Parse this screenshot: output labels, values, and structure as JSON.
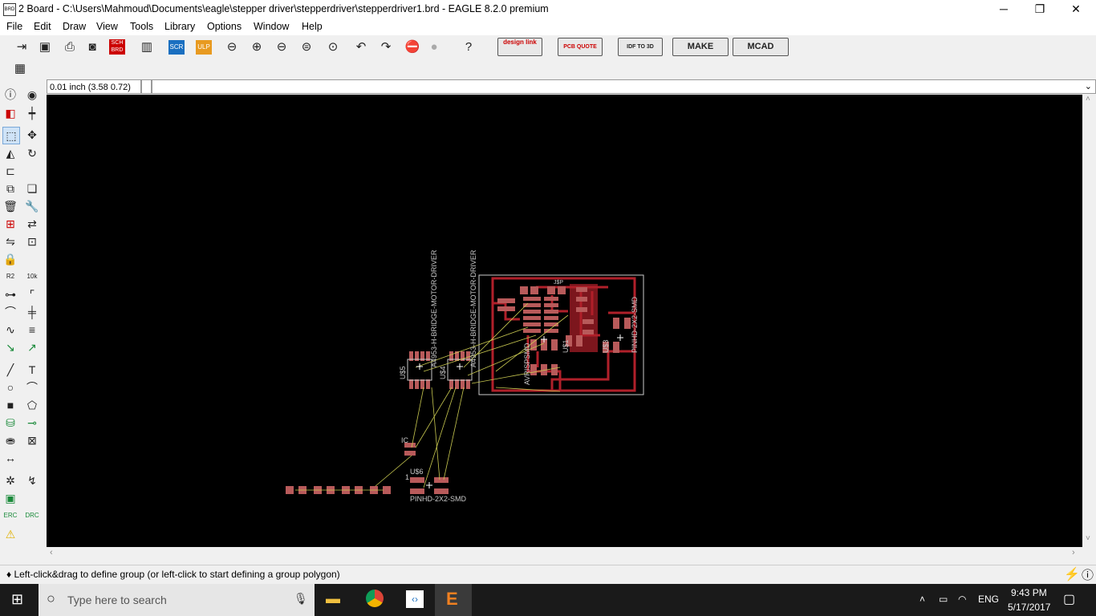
{
  "window": {
    "app_icon_text": "BRD",
    "title": "2 Board - C:\\Users\\Mahmoud\\Documents\\eagle\\stepper driver\\stepperdriver\\stepperdriver1.brd - EAGLE 8.2.0 premium",
    "minimize": "─",
    "restore": "❐",
    "close": "✕"
  },
  "menu": [
    "File",
    "Edit",
    "Draw",
    "View",
    "Tools",
    "Library",
    "Options",
    "Window",
    "Help"
  ],
  "toolbar": {
    "sch_brd": "SCH BRD",
    "scr": "SCR",
    "ulp": "ULP",
    "design_link": "design link",
    "pcb_quote": "PCB QUOTE",
    "idf_3d": "IDF TO 3D",
    "make": "MAKE",
    "mcad": "MCAD"
  },
  "coords": {
    "value": "0.01 inch (3.58 0.72)"
  },
  "status": {
    "message": "♦ Left-click&drag to define group (or left-click to start defining a group polygon)"
  },
  "board": {
    "u5": "U$5",
    "u4": "U$4",
    "driver1": "A4953-H-BRIDGE-MOTOR-DRIVER",
    "driver2": "A4953-H-BRIDGE-MOTOR-DRIVER",
    "avrisp": "AVRISPSMD",
    "u1": "U$1",
    "u3": "U$3",
    "pinhd_top": "PINHD-2X2-SMD",
    "ic": "IC",
    "u6": "U$6",
    "pinhd_bottom": "PINHD-2X2-SMD",
    "one": "1",
    "jp": "J$P"
  },
  "taskbar": {
    "search_placeholder": "Type here to search",
    "lang": "ENG",
    "time": "9:43 PM",
    "date": "5/17/2017"
  },
  "colors": {
    "canvas": "#000000",
    "trace": "#b0202a",
    "pad": "#b85a5a",
    "airwire": "#c8c850",
    "outline": "#cccccc",
    "silk": "#c8c8c8"
  }
}
